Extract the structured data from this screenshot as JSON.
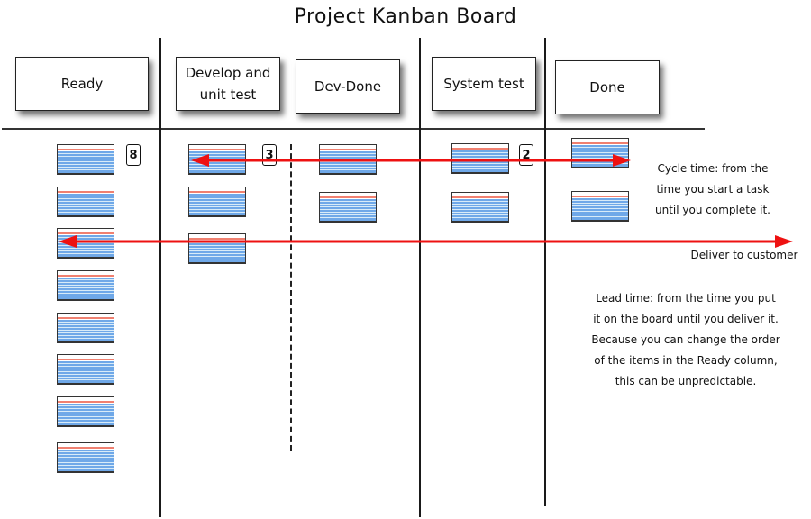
{
  "title": "Project Kanban Board",
  "columns": [
    {
      "id": "ready",
      "label": "Ready",
      "wip_limit": "8",
      "card_count": 8
    },
    {
      "id": "develop",
      "label": "Develop and unit test",
      "label_lines": [
        "Develop and",
        "unit test"
      ],
      "wip_limit": "3",
      "card_count": 3
    },
    {
      "id": "dev-done",
      "label": "Dev-Done",
      "card_count": 2
    },
    {
      "id": "system-test",
      "label": "System test",
      "wip_limit": "2",
      "card_count": 2
    },
    {
      "id": "done",
      "label": "Done",
      "card_count": 2
    }
  ],
  "annotations": {
    "cycle_time": [
      "Cycle time: from the",
      "time you start a task",
      "until you complete it."
    ],
    "deliver": "Deliver to customer",
    "lead_time": [
      "Lead time: from the time you put",
      "it on the board until you deliver it.",
      "Because you can change the order",
      "of the items in the Ready column,",
      "this can be unpredictable."
    ]
  },
  "colors": {
    "arrow": "#ee1111",
    "card_line_red": "#f08070",
    "card_line_blue": "#6fa8e8"
  }
}
